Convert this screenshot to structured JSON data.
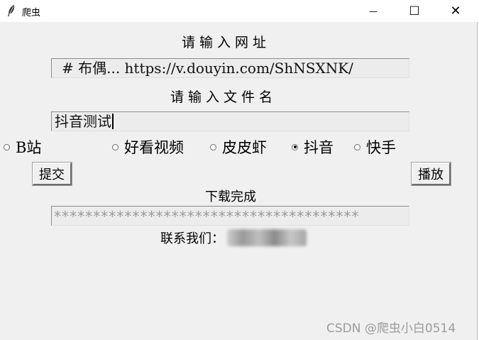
{
  "window": {
    "title": "爬虫",
    "minimize_glyph": "—",
    "maximize_glyph": "☐",
    "close_glyph": "✕"
  },
  "form": {
    "url_label": "请输入网址",
    "url_value": "# 布偶... https://v.douyin.com/ShNSXNK/",
    "filename_label": "请输入文件名",
    "filename_value": "抖音测试"
  },
  "platforms": [
    {
      "label": "B站",
      "selected": false
    },
    {
      "label": "好看视频",
      "selected": false
    },
    {
      "label": "皮皮虾",
      "selected": false
    },
    {
      "label": "抖音",
      "selected": true
    },
    {
      "label": "快手",
      "selected": false
    }
  ],
  "buttons": {
    "submit": "提交",
    "play": "播放"
  },
  "status": {
    "text": "下载完成",
    "progress": "***************************************"
  },
  "contact": {
    "label": "联系我们："
  },
  "watermark": "CSDN @爬虫小白0514"
}
